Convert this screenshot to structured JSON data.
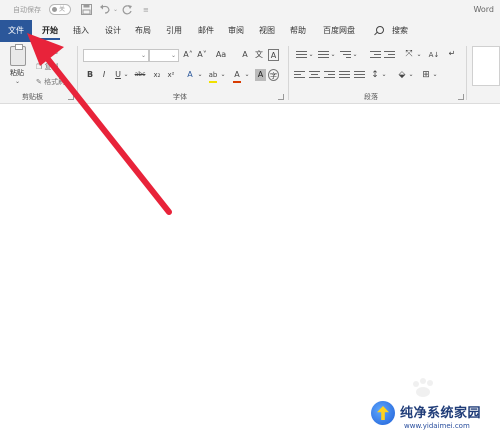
{
  "quick_access": {
    "autosave_label": "自动保存",
    "autosave_state": "关",
    "undo_icon": "undo-icon",
    "redo_icon": "redo-icon",
    "save_icon": "save-icon",
    "customize_icon": "customize-qat-icon"
  },
  "app_name": "Word",
  "tabs": [
    {
      "label": "文件"
    },
    {
      "label": "开始"
    },
    {
      "label": "插入"
    },
    {
      "label": "设计"
    },
    {
      "label": "布局"
    },
    {
      "label": "引用"
    },
    {
      "label": "邮件"
    },
    {
      "label": "审阅"
    },
    {
      "label": "视图"
    },
    {
      "label": "帮助"
    },
    {
      "label": "百度网盘"
    }
  ],
  "search": {
    "label": "搜索"
  },
  "ribbon": {
    "clipboard": {
      "paste_label": "粘贴",
      "cut_label": "剪切",
      "copy_label": "复制",
      "format_painter_label": "格式刷",
      "group_label": "剪贴板"
    },
    "font": {
      "font_name_value": "",
      "font_size_value": "",
      "grow_label": "A˄",
      "shrink_label": "A˅",
      "case_label": "Aa",
      "clear_label": "A",
      "phonetic_label": "文",
      "border_label": "A",
      "bold_label": "B",
      "italic_label": "I",
      "underline_label": "U",
      "strike_label": "abc",
      "subscript_label": "x₂",
      "superscript_label": "x²",
      "effects_label": "A",
      "highlight_label": "ab",
      "color_label": "A",
      "shading_label": "A",
      "enclose_label": "字",
      "group_label": "字体",
      "highlight_color": "#f0e000",
      "font_color": "#d83b01"
    },
    "paragraph": {
      "group_label": "段落",
      "sort_label": "A↓",
      "marks_label": "↵"
    }
  },
  "watermark": {
    "title": "纯净系统家园",
    "url": "www.yidaimei.com"
  },
  "colors": {
    "accent": "#2b579a",
    "annotation_arrow": "#e8233a"
  }
}
